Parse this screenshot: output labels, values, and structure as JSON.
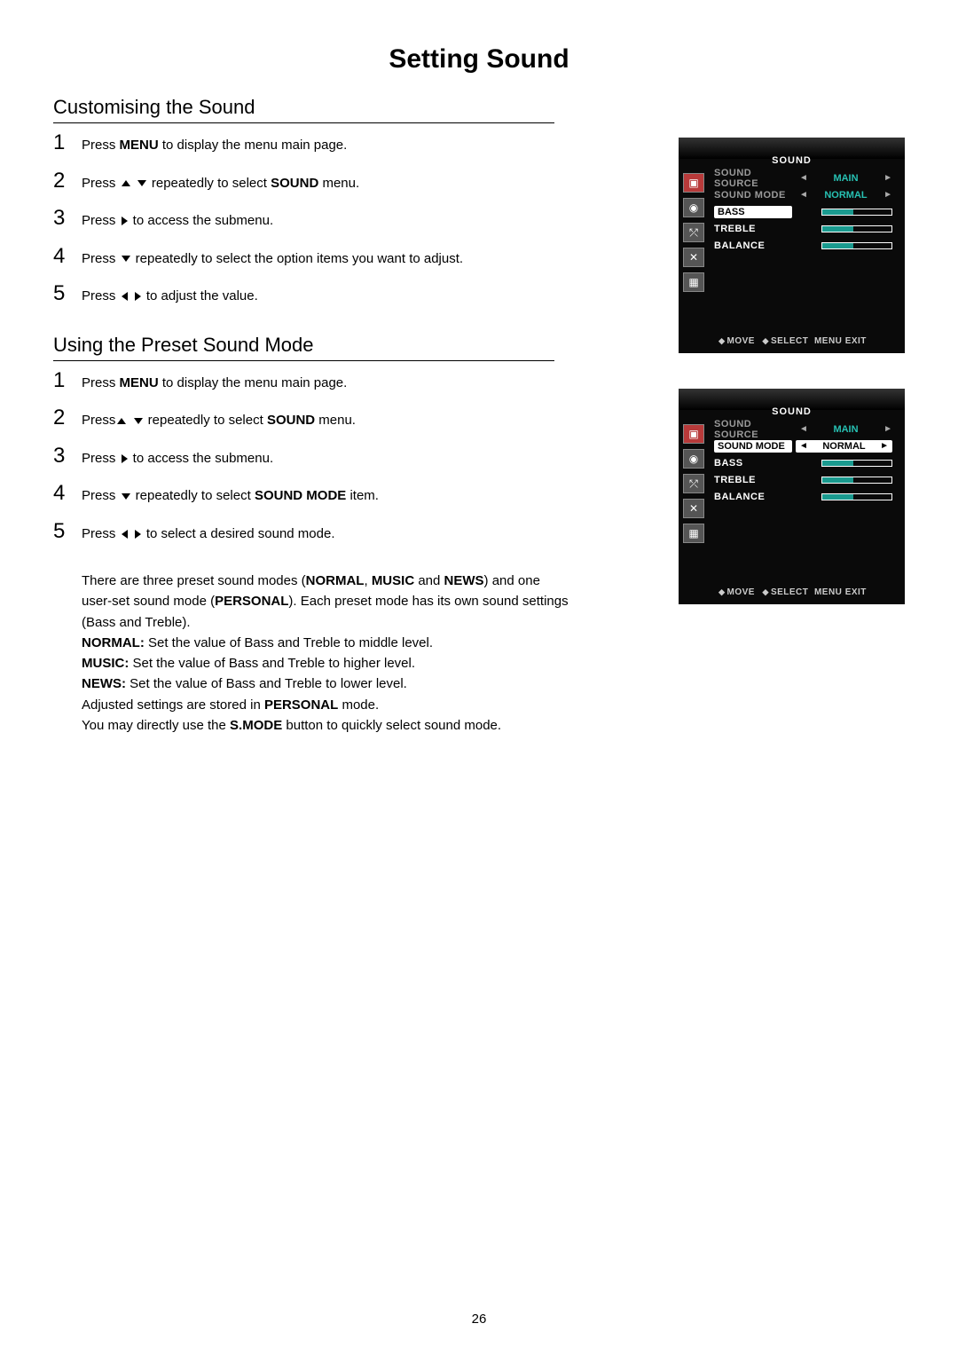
{
  "page_title": "Setting Sound",
  "page_number": "26",
  "section1": {
    "heading": "Customising the Sound",
    "s1_pre": "Press ",
    "s1_menu": "MENU",
    "s1_post": " to display the menu main page.",
    "s2_pre": "Press ",
    "s2_mid": " repeatedly to select ",
    "s2_sound": "SOUND",
    "s2_post": " menu.",
    "s3_pre": "Press ",
    "s3_post": " to access the submenu.",
    "s4_pre": "Press ",
    "s4_post": " repeatedly to select the option items you want to adjust.",
    "s5_pre": "Press ",
    "s5_post": " to adjust the value."
  },
  "section2": {
    "heading": "Using the Preset Sound Mode",
    "s1_pre": "Press ",
    "s1_menu": "MENU",
    "s1_post": " to display the menu main page.",
    "s2_pre": "Press",
    "s2_mid": " repeatedly to select ",
    "s2_sound": "SOUND",
    "s2_post": " menu.",
    "s3_pre": "Press ",
    "s3_post": " to access the submenu.",
    "s4_pre": "Press ",
    "s4_mid": " repeatedly to select ",
    "s4_bold": "SOUND MODE",
    "s4_post": " item.",
    "s5_pre": "Press ",
    "s5_post": " to select a desired sound mode."
  },
  "narrative": {
    "l1a": "There are three preset sound modes (",
    "l1b": "NORMAL",
    "l1c": ", ",
    "l1d": "MUSIC",
    "l1e": " and ",
    "l1f": "NEWS",
    "l1g": ") and one",
    "l2a": "user-set sound mode (",
    "l2b": "PERSONAL",
    "l2c": "). Each preset mode has its own sound settings",
    "l3": "(Bass and Treble).",
    "l4a": "NORMAL:",
    "l4b": " Set the value of Bass and Treble to middle level.",
    "l5a": "MUSIC:",
    "l5b": " Set the value of Bass and Treble to higher level.",
    "l6a": "NEWS:",
    "l6b": " Set the value of Bass and Treble to lower level.",
    "l7a": "Adjusted settings are stored in ",
    "l7b": "PERSONAL",
    "l7c": " mode.",
    "l8a": "You may directly use the ",
    "l8b": "S.MODE",
    "l8c": " button to quickly select sound mode."
  },
  "osd": {
    "title": "SOUND",
    "sound_source_label": "SOUND SOURCE",
    "sound_source_value": "MAIN",
    "sound_mode_label": "SOUND MODE",
    "sound_mode_value": "NORMAL",
    "bass_label": "BASS",
    "treble_label": "TREBLE",
    "balance_label": "BALANCE",
    "footer_move": "MOVE",
    "footer_select": "SELECT",
    "footer_menu": "MENU",
    "footer_exit": "EXIT"
  }
}
